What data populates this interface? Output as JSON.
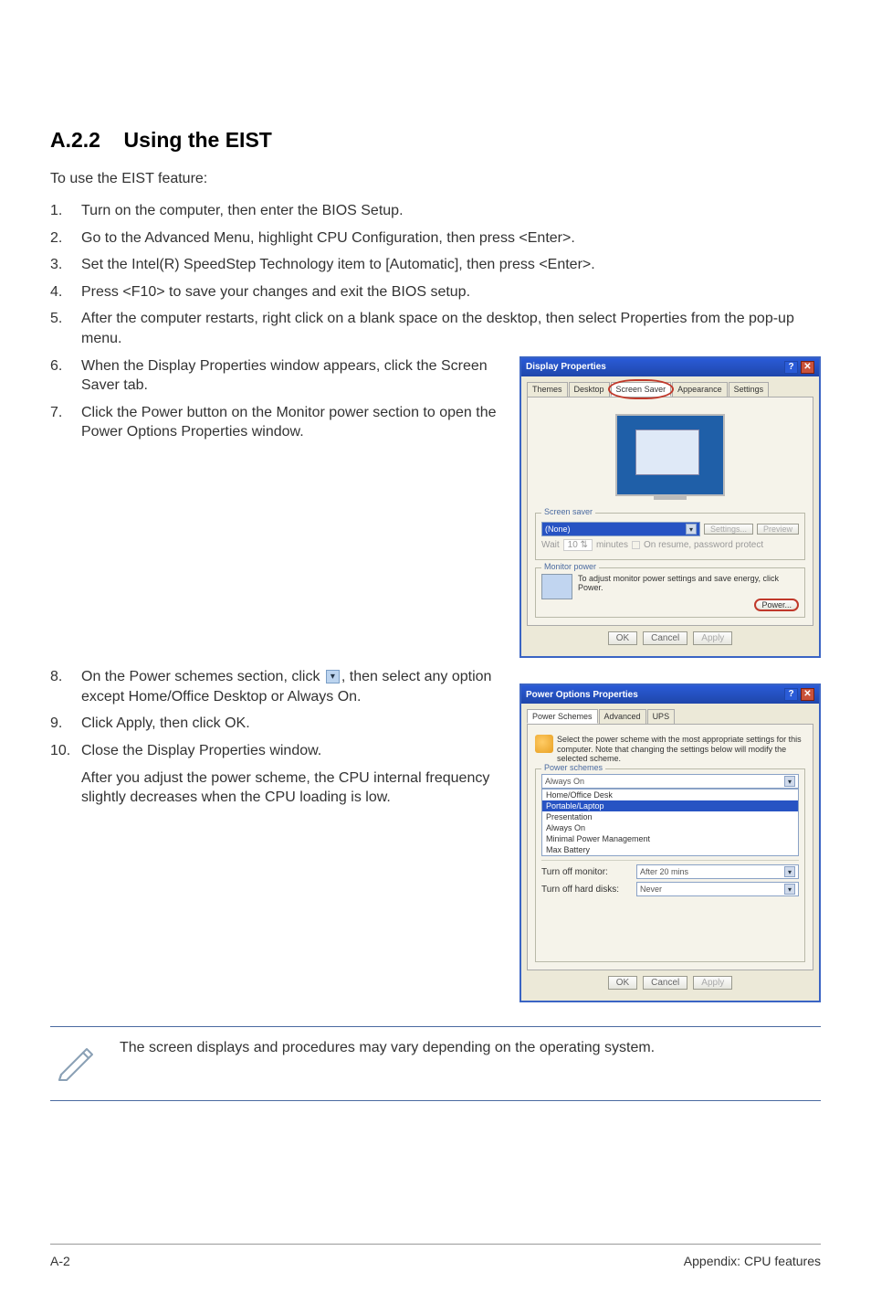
{
  "section": {
    "number": "A.2.2",
    "title": "Using the EIST"
  },
  "intro": "To use the EIST feature:",
  "steps": {
    "s1": "Turn on the computer, then enter the BIOS Setup.",
    "s2": "Go to the Advanced Menu, highlight CPU Configuration, then press <Enter>.",
    "s3": "Set the Intel(R) SpeedStep Technology item to [Automatic], then press <Enter>.",
    "s4": "Press <F10> to save your changes and exit the BIOS setup.",
    "s5": "After the computer restarts, right click on a blank space on the desktop, then select Properties from the pop-up menu.",
    "s6": "When the Display Properties window appears, click the Screen Saver tab.",
    "s7": "Click the Power button on the Monitor power section to open the Power Options Properties window.",
    "s8a": "On the Power schemes section, click ",
    "s8b": ", then select any option except Home/Office Desktop or Always On.",
    "s9": "Click Apply, then click OK.",
    "s10": "Close the Display Properties window.",
    "tail": "After you adjust the power scheme, the CPU internal frequency slightly decreases when the CPU loading is low."
  },
  "dialog1": {
    "title": "Display Properties",
    "tabs": {
      "themes": "Themes",
      "desktop": "Desktop",
      "screensaver": "Screen Saver",
      "appearance": "Appearance",
      "settings": "Settings"
    },
    "group_ss": "Screen saver",
    "ss_selected": "(None)",
    "btn_settings": "Settings...",
    "btn_preview": "Preview",
    "wait_label": "Wait",
    "wait_value": "10",
    "wait_unit": "minutes",
    "resume_chk": "On resume, password protect",
    "group_mp": "Monitor power",
    "mp_text": "To adjust monitor power settings and save energy, click Power.",
    "btn_power": "Power...",
    "ok": "OK",
    "cancel": "Cancel",
    "apply": "Apply"
  },
  "dialog2": {
    "title": "Power Options Properties",
    "tabs": {
      "schemes": "Power Schemes",
      "advanced": "Advanced",
      "ups": "UPS"
    },
    "blurb": "Select the power scheme with the most appropriate settings for this computer. Note that changing the settings below will modify the selected scheme.",
    "group_ps": "Power schemes",
    "scheme_selected": "Always On",
    "scheme_options": [
      "Home/Office Desk",
      "Portable/Laptop",
      "Presentation",
      "Always On",
      "Minimal Power Management",
      "Max Battery"
    ],
    "turnoff_monitor_label": "Turn off monitor:",
    "turnoff_monitor_value": "After 20 mins",
    "turnoff_hd_label": "Turn off hard disks:",
    "turnoff_hd_value": "Never",
    "ok": "OK",
    "cancel": "Cancel",
    "apply": "Apply"
  },
  "note": "The screen displays and procedures may vary depending on the operating system.",
  "footer": {
    "left": "A-2",
    "right": "Appendix: CPU features"
  }
}
